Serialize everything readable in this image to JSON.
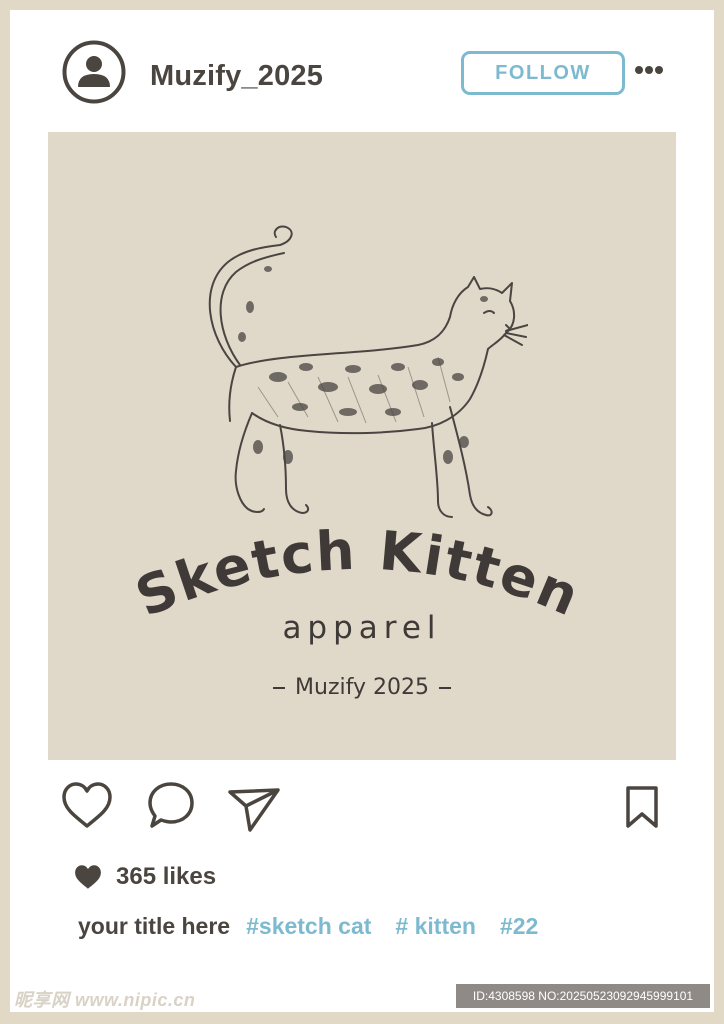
{
  "post": {
    "username": "Muzify_2025",
    "follow_label": "FOLLOW",
    "more_icon": "more-horizontal-icon",
    "avatar_icon": "user-avatar-icon"
  },
  "image": {
    "brand": "Sketch Kitten",
    "apparel": "apparel",
    "subline": "Muzify 2025"
  },
  "actions": {
    "like_icon": "heart-outline-icon",
    "comment_icon": "comment-bubble-icon",
    "share_icon": "send-paper-plane-icon",
    "save_icon": "bookmark-icon"
  },
  "likes": {
    "text": "365 likes"
  },
  "caption": {
    "title": "your title here",
    "tags": [
      "#sketch cat",
      "# kitten",
      "#22"
    ]
  },
  "watermark": {
    "site": "昵享网 www.nipic.cn",
    "id_text": "ID:4308598 NO:20250523092945999101"
  },
  "colors": {
    "accent": "#7dbad0",
    "text_dark": "#4b4540",
    "background": "#e2d8c6",
    "photo_bg": "#e0d8c8"
  }
}
